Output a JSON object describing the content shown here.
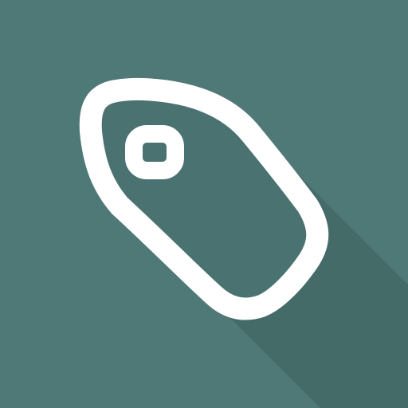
{
  "icon": {
    "name": "price-tag-icon",
    "colors": {
      "background": "#4f7977",
      "long_shadow": "#456b69",
      "tag_fill": "#4a7270",
      "tag_stroke": "#ffffff"
    }
  }
}
